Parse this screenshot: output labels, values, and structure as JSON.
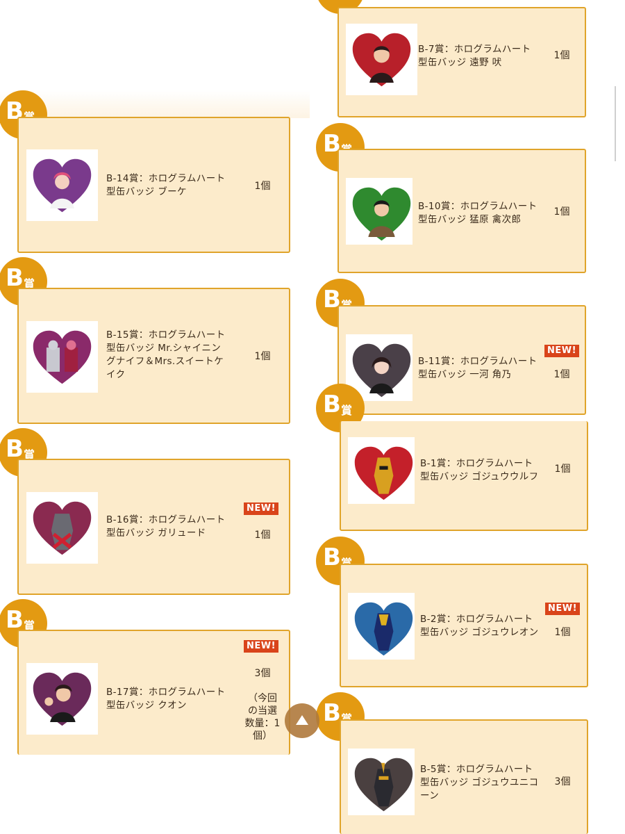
{
  "badge_letter": "B",
  "badge_kanji": "賞",
  "new_label": "NEW!",
  "items": [
    {
      "name_lines": [
        "B-7賞：ホログラムハート",
        "型缶バッジ 遠野 吠"
      ],
      "qty_lines": [
        "1個"
      ],
      "new": false,
      "heart_color": "#b8202a"
    },
    {
      "name_lines": [
        "B-14賞：ホログラムハート",
        "型缶バッジ ブーケ"
      ],
      "qty_lines": [
        "1個"
      ],
      "new": false,
      "heart_color": "#7a3a8c"
    },
    {
      "name_lines": [
        "B-10賞：ホログラムハート",
        "型缶バッジ 猛原 禽次郎"
      ],
      "qty_lines": [
        "1個"
      ],
      "new": false,
      "heart_color": "#2f8a2f"
    },
    {
      "name_lines": [
        "B-15賞：ホログラムハート",
        "型缶バッジ Mr.シャイニン",
        "グナイフ＆Mrs.スイートケ",
        "イク"
      ],
      "qty_lines": [
        "1個"
      ],
      "new": false,
      "heart_color": "#8a2a6a"
    },
    {
      "name_lines": [
        "B-11賞：ホログラムハート",
        "型缶バッジ 一河 角乃"
      ],
      "qty_lines": [
        "1個"
      ],
      "new": true,
      "heart_color": "#4a4048"
    },
    {
      "name_lines": [
        "B-1賞：ホログラムハート",
        "型缶バッジ ゴジュウウルフ"
      ],
      "qty_lines": [
        "1個"
      ],
      "new": false,
      "heart_color": "#c4202a"
    },
    {
      "name_lines": [
        "B-16賞：ホログラムハート",
        "型缶バッジ ガリュード"
      ],
      "qty_lines": [
        "1個"
      ],
      "new": true,
      "heart_color": "#8a2a50"
    },
    {
      "name_lines": [
        "B-2賞：ホログラムハート",
        "型缶バッジ ゴジュウレオン"
      ],
      "qty_lines": [
        "1個"
      ],
      "new": true,
      "heart_color": "#2a6aa8"
    },
    {
      "name_lines": [
        "B-17賞：ホログラムハート",
        "型缶バッジ クオン"
      ],
      "qty_lines": [
        "3個",
        "",
        "（今回",
        "の当選",
        "数量：1",
        "個）"
      ],
      "new": true,
      "heart_color": "#6a2a5a"
    },
    {
      "name_lines": [
        "B-5賞：ホログラムハート",
        "型缶バッジ ゴジュウユニコ",
        "ーン"
      ],
      "qty_lines": [
        "3個"
      ],
      "new": false,
      "heart_color": "#4a4040"
    }
  ]
}
